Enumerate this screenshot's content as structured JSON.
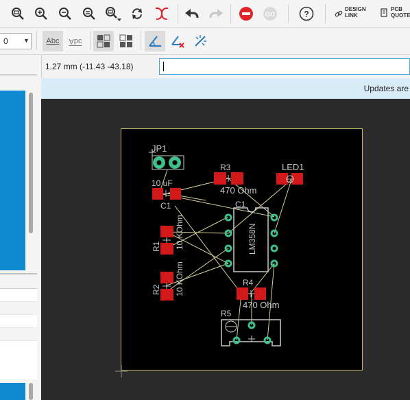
{
  "toolbar": {
    "icons": [
      "zoom-fit-icon",
      "zoom-in-icon",
      "zoom-out-icon",
      "zoom-select-icon",
      "zoom-last-icon",
      "redraw-icon",
      "ratsnest-icon",
      "undo-icon",
      "redo-icon",
      "stop-icon",
      "go-icon",
      "help-icon"
    ],
    "design_link_line1": "DESIGN",
    "design_link_line2": "LINK",
    "pcb_quote_line1": "PCB",
    "pcb_quote_line2": "QUOTE"
  },
  "toolbar2": {
    "layer_value": "0",
    "abc_label": "Abc",
    "abc_mirror_label": "Abc",
    "icons": [
      "grid-layout-icon",
      "grid-layout-alt-icon",
      "angle-tool-icon",
      "angle-delete-icon",
      "spark-icon"
    ]
  },
  "status": {
    "coordinates": "1.27 mm (-11.43 -43.18)",
    "command_value": "",
    "banner": "Updates are"
  },
  "board": {
    "labels": {
      "jp1": "JP1",
      "r3": "R3",
      "led1": "LED1",
      "c1_value": "10 uF",
      "r3_value": "470 Ohm",
      "c1_name": "C1",
      "c1_name2": "C1",
      "ic": "LM358N",
      "r1": "R1",
      "r1_value": "10 KOhm",
      "r2": "R2",
      "r2_value": "10 KOhm",
      "r4": "R4",
      "r4_value": "470 Ohm",
      "r5": "R5"
    },
    "colors": {
      "board": "#000000",
      "outline": "#c9ad6a",
      "pad": "#d11919",
      "via": "#3fbf8a",
      "silk": "#c8c8c8",
      "airwire": "#d8d29a"
    }
  }
}
